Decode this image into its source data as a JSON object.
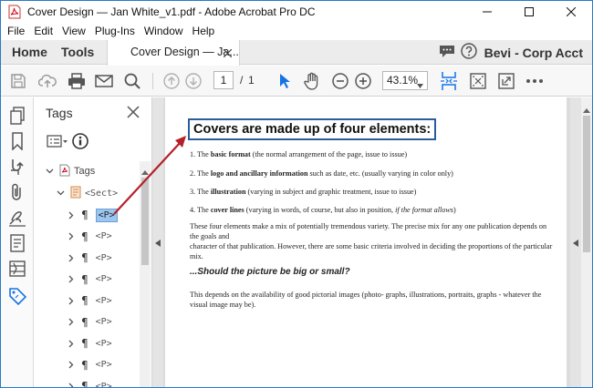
{
  "window": {
    "title": "Cover Design — Jan White_v1.pdf - Adobe Acrobat Pro DC",
    "controls": [
      "minimize-icon",
      "maximize-icon",
      "close-icon"
    ]
  },
  "menu": [
    "File",
    "Edit",
    "View",
    "Plug-Ins",
    "Window",
    "Help"
  ],
  "tabs": {
    "home": "Home",
    "tools": "Tools",
    "document": "Cover Design — Ja...",
    "account": "Bevi - Corp Acct"
  },
  "toolbar": {
    "page_current": "1",
    "page_separator": "/",
    "page_total": "1",
    "zoom": "43.1%"
  },
  "tags_panel": {
    "title": "Tags",
    "root": "Tags",
    "sect": "<Sect>",
    "items": [
      "<P>",
      "<P>",
      "<P>",
      "<P>",
      "<P>",
      "<P>",
      "<P>",
      "<P>",
      "<P>"
    ]
  },
  "document": {
    "heading": "Covers are made up of four elements:",
    "item1": {
      "num": "1. The ",
      "bold": "basic format",
      "rest": " (the normal arrangement of the page, issue to issue)"
    },
    "item2": {
      "num": "2. The ",
      "bold": "logo and ancillary information",
      "rest": " such as date, etc. (usually varying in color only)"
    },
    "item3": {
      "num": "3. The ",
      "bold": "illustration",
      "rest": " (varying in subject and graphic treatment, issue to issue)"
    },
    "item4": {
      "num": "4. The ",
      "bold": "cover lines",
      "rest": " (varying in words, of course, but also in position, ",
      "italic": "if the format allows",
      "end": ")"
    },
    "para1_line1": "These four elements make a mix of potentially tremendous variety.  The precise mix for any one publication depends on",
    "para1_line2": "the goals and",
    "para1_line3": "character of that publication.  However, there are some basic criteria involved in deciding the proportions of the particular",
    "para1_line4": "mix.",
    "subheading": "...Should the picture be big or small?",
    "para2_line1": "This depends on the availability of good pictorial images (photo- graphs, illustrations, portraits, graphs - whatever the",
    "para2_line2": "visual image may be)."
  },
  "colors": {
    "accent": "#1473e6",
    "annotation_arrow": "#b5202a",
    "heading_border": "#2b5c9b",
    "selected_tag": "#9cc6ef"
  }
}
